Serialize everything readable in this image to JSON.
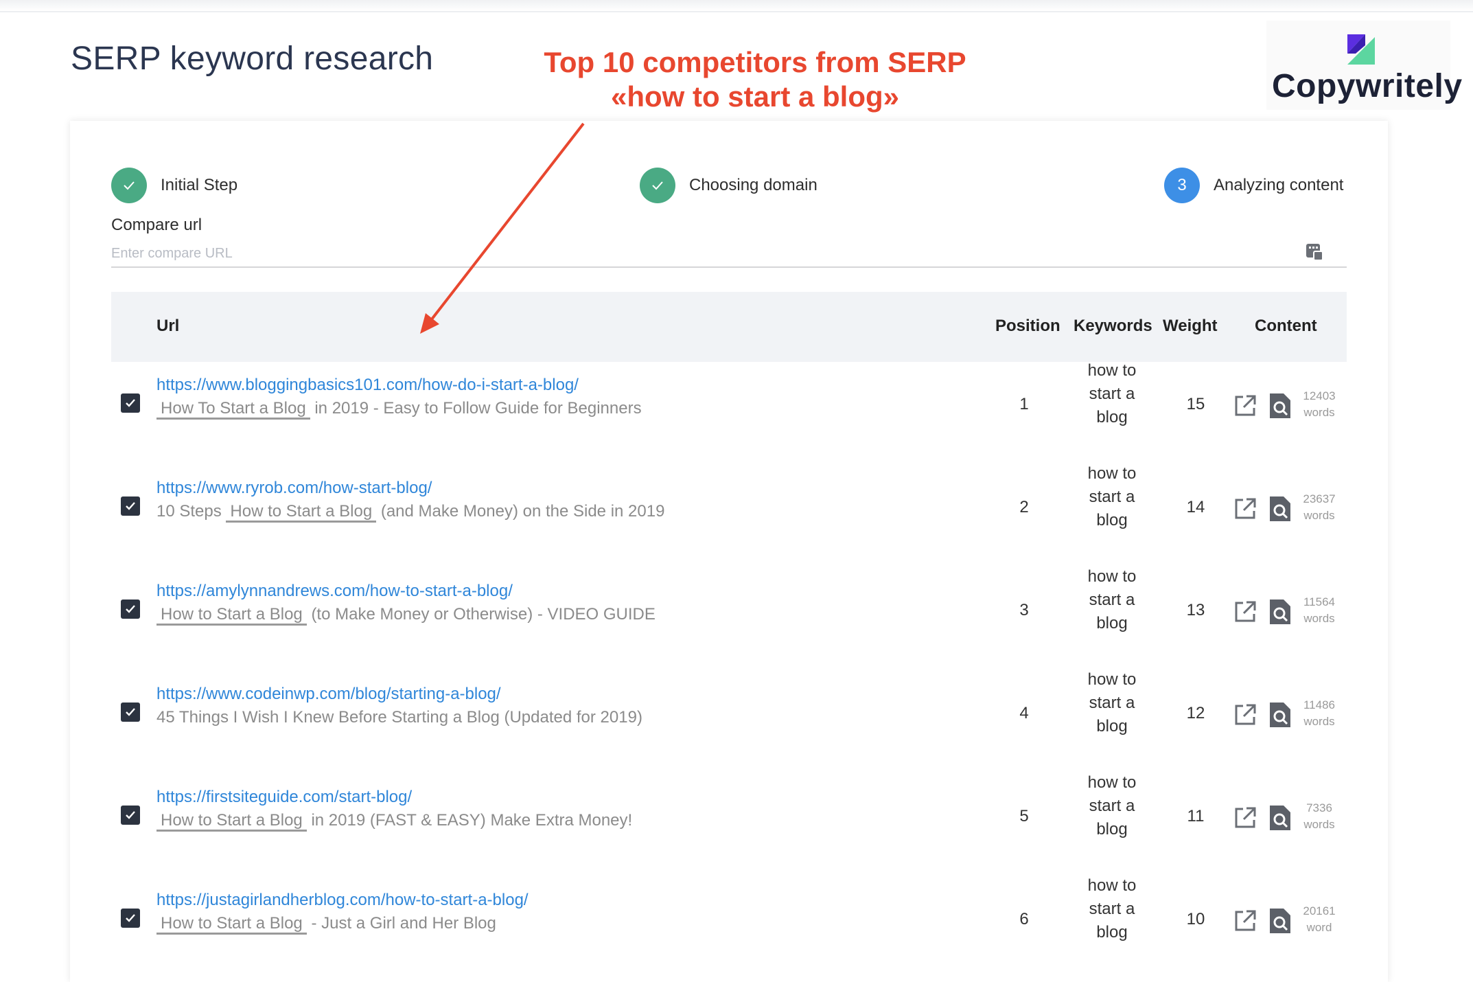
{
  "header": {
    "title": "SERP keyword research",
    "annotation_line1": "Top 10 competitors from SERP",
    "annotation_line2": "«how to start a blog»",
    "logo_text": "Copywritely"
  },
  "steps": [
    {
      "label": "Initial Step",
      "status": "done"
    },
    {
      "label": "Choosing domain",
      "status": "done"
    },
    {
      "number": "3",
      "label": "Analyzing content",
      "status": "active"
    }
  ],
  "compare": {
    "label": "Compare url",
    "placeholder": "Enter compare URL"
  },
  "table": {
    "headers": {
      "url": "Url",
      "position": "Position",
      "keywords": "Keywords",
      "weight": "Weight",
      "content": "Content"
    },
    "rows": [
      {
        "checked": true,
        "url": "https://www.bloggingbasics101.com/how-do-i-start-a-blog/",
        "title_before": "",
        "title_highlight": "How To Start a Blog",
        "title_after": "in 2019 - Easy to Follow Guide for Beginners",
        "position": "1",
        "kw1": "how to",
        "kw2": "start a",
        "kw3": "blog",
        "weight": "15",
        "words_count": "12403",
        "words_unit": "words"
      },
      {
        "checked": true,
        "url": "https://www.ryrob.com/how-start-blog/",
        "title_before": "10 Steps",
        "title_highlight": "How to Start a Blog",
        "title_after": "(and Make Money) on the Side in 2019",
        "position": "2",
        "kw1": "how to",
        "kw2": "start a",
        "kw3": "blog",
        "weight": "14",
        "words_count": "23637",
        "words_unit": "words"
      },
      {
        "checked": true,
        "url": "https://amylynnandrews.com/how-to-start-a-blog/",
        "title_before": "",
        "title_highlight": "How to Start a Blog",
        "title_after": "(to Make Money or Otherwise) - VIDEO GUIDE",
        "position": "3",
        "kw1": "how to",
        "kw2": "start a",
        "kw3": "blog",
        "weight": "13",
        "words_count": "11564",
        "words_unit": "words"
      },
      {
        "checked": true,
        "url": "https://www.codeinwp.com/blog/starting-a-blog/",
        "title_before": "45 Things I Wish I Knew Before Starting a Blog (Updated for 2019)",
        "title_highlight": "",
        "title_after": "",
        "position": "4",
        "kw1": "how to",
        "kw2": "start a",
        "kw3": "blog",
        "weight": "12",
        "words_count": "11486",
        "words_unit": "words"
      },
      {
        "checked": true,
        "url": "https://firstsiteguide.com/start-blog/",
        "title_before": "",
        "title_highlight": "How to Start a Blog",
        "title_after": "in 2019 (FAST & EASY) Make Extra Money!",
        "position": "5",
        "kw1": "how to",
        "kw2": "start a",
        "kw3": "blog",
        "weight": "11",
        "words_count": "7336",
        "words_unit": "words"
      },
      {
        "checked": true,
        "url": "https://justagirlandherblog.com/how-to-start-a-blog/",
        "title_before": "",
        "title_highlight": "How to Start a Blog",
        "title_after": "- Just a Girl and Her Blog",
        "position": "6",
        "kw1": "how to",
        "kw2": "start a",
        "kw3": "blog",
        "weight": "10",
        "words_count": "20161",
        "words_unit": "word"
      }
    ]
  },
  "colors": {
    "accent_blue": "#3d8fe6",
    "done_green": "#4aaa84",
    "annotation_red": "#e8472f",
    "link_blue": "#2f86d9"
  }
}
